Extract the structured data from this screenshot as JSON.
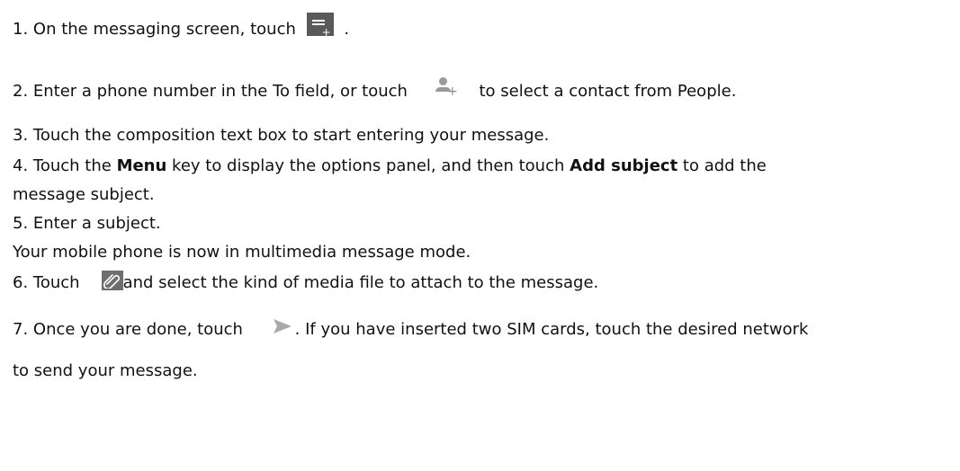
{
  "steps": {
    "s1": {
      "pre": "1. On the messaging screen, touch",
      "post": "."
    },
    "s2": {
      "pre": "2. Enter a phone number in the To field, or touch",
      "post": "to select a contact from People."
    },
    "s3": {
      "text": "3. Touch the composition text box to start entering your message."
    },
    "s4": {
      "pre": "4. Touch the",
      "bold1": "Menu",
      "mid": " key to display the options panel, and then touch",
      "bold2": "Add subject",
      "post": " to add the",
      "cont": "message subject."
    },
    "s5": {
      "text": "5. Enter a subject.",
      "note": "Your mobile phone is now in multimedia message mode."
    },
    "s6": {
      "pre": "6. Touch",
      "post": "and select the kind of media file to attach to the message."
    },
    "s7": {
      "pre": "7. Once you are done, touch",
      "post": ". If you have inserted two SIM cards, touch the desired network",
      "cont": "to send your message."
    }
  },
  "icons": {
    "compose": "compose-new-message-icon",
    "add_contact": "add-contact-icon",
    "attach": "paperclip-attach-icon",
    "send": "send-arrow-icon"
  },
  "colors": {
    "text": "#111111",
    "icon_dark": "#5a5a5a",
    "icon_light": "#9a9a9a"
  }
}
